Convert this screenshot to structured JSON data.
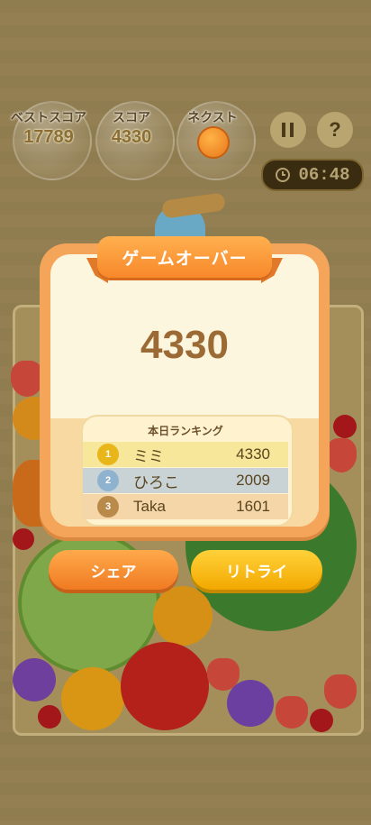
{
  "hud": {
    "best_label": "ベストスコア",
    "best_value": "17789",
    "score_label": "スコア",
    "score_value": "4330",
    "next_label": "ネクスト",
    "next_fruit_icon": "orange-icon",
    "pause_icon": "pause-icon",
    "help_label": "?",
    "timer": "06:48"
  },
  "dialog": {
    "title": "ゲームオーバー",
    "final_score": "4330",
    "ranking_title": "本日ランキング",
    "ranking": [
      {
        "rank": "1",
        "name": "ミミ",
        "score": "4330",
        "color": "#f7e79a"
      },
      {
        "rank": "2",
        "name": "ひろこ",
        "score": "2009",
        "color": "#c9d3d6"
      },
      {
        "rank": "3",
        "name": "Taka",
        "score": "1601",
        "color": "#f4d6a8"
      }
    ]
  },
  "buttons": {
    "share": "シェア",
    "retry": "リトライ"
  },
  "colors": {
    "accent_orange": "#f7882a",
    "accent_yellow": "#f3a800",
    "panel_cream": "#fdf6de"
  }
}
